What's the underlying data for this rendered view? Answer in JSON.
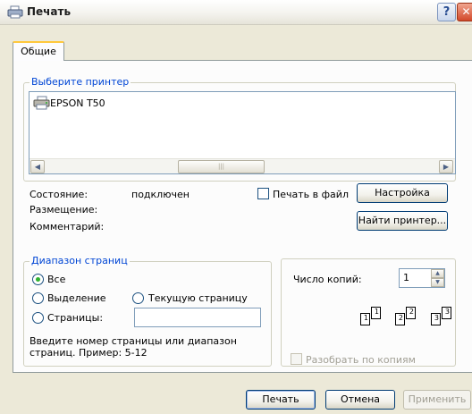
{
  "window": {
    "title": "Печать",
    "help_label": "?",
    "close_label": "✕"
  },
  "tabs": [
    {
      "label": "Общие",
      "selected": true
    }
  ],
  "printer_group": {
    "legend": "Выберите принтер",
    "printers": [
      {
        "name": "EPSON T50",
        "icon": "printer-icon"
      }
    ],
    "scroll_left": "◀",
    "scroll_right": "▶",
    "scroll_thumb": "|||"
  },
  "printer_info": {
    "status_label": "Состояние:",
    "status_value": "подключен",
    "location_label": "Размещение:",
    "comment_label": "Комментарий:",
    "print_to_file_label": "Печать в файл",
    "print_to_file_checked": false,
    "settings_button": "Настройка",
    "find_printer_button": "Найти принтер..."
  },
  "page_range": {
    "legend": "Диапазон страниц",
    "all_label": "Все",
    "selection_label": "Выделение",
    "current_page_label": "Текущую страницу",
    "pages_label": "Страницы:",
    "pages_value": "",
    "selected_option": "all",
    "hint": [
      "Введите номер страницы или диапазон",
      "страниц.  Пример: 5-12"
    ]
  },
  "copies": {
    "label": "Число копий:",
    "value": "1",
    "collate_label": "Разобрать по копиям",
    "collate_checked": false,
    "collate_pages": [
      [
        "1",
        "1"
      ],
      [
        "2",
        "2"
      ],
      [
        "3",
        "3"
      ]
    ]
  },
  "buttons": {
    "print": "Печать",
    "cancel": "Отмена",
    "apply": "Применить"
  },
  "colors": {
    "accent": "#0046d5",
    "radio_dot": "#2fb12f",
    "tab_highlight": "#ffc83c"
  }
}
